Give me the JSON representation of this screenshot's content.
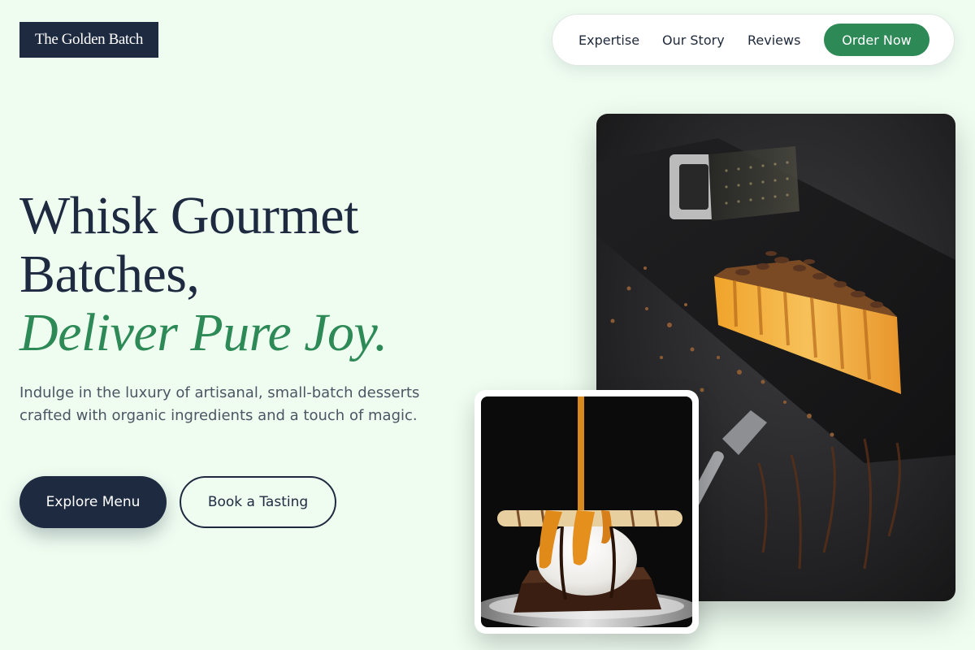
{
  "brand": {
    "name": "The Golden Batch"
  },
  "nav": {
    "links": [
      "Expertise",
      "Our Story",
      "Reviews"
    ],
    "cta_label": "Order Now"
  },
  "hero": {
    "headline_line1": "Whisk Gourmet",
    "headline_line2": "Batches,",
    "headline_accent": "Deliver Pure Joy.",
    "subtitle": "Indulge in the luxury of artisanal, small-batch desserts crafted with organic ingredients and a touch of magic.",
    "primary_button": "Explore Menu",
    "secondary_button": "Book a Tasting"
  },
  "images": {
    "main": "cheesecake-slice-photo",
    "inset": "ice-cream-brownie-photo"
  },
  "colors": {
    "background": "#effdf1",
    "navy": "#1e2a40",
    "accent_green": "#2d8a56"
  }
}
